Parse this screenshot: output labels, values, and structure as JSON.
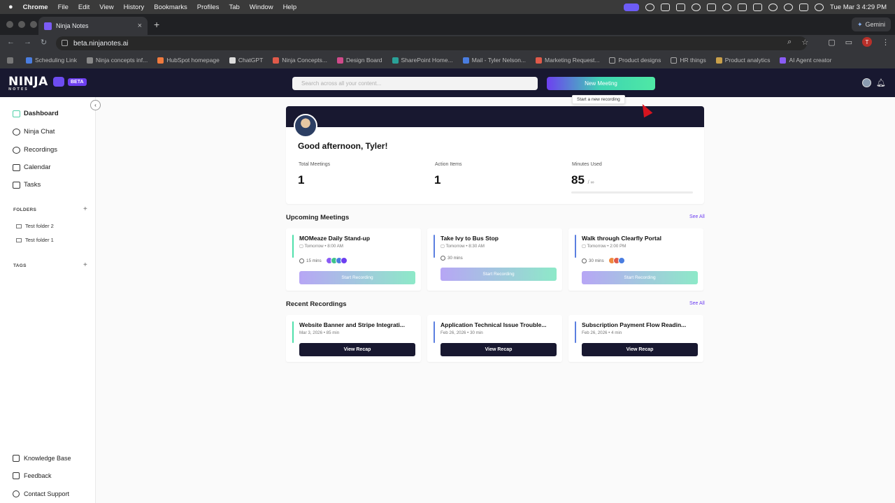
{
  "mac_menu": {
    "items": [
      "Chrome",
      "File",
      "Edit",
      "View",
      "History",
      "Bookmarks",
      "Profiles",
      "Tab",
      "Window",
      "Help"
    ],
    "date_time": "Tue Mar 3  4:29 PM"
  },
  "browser": {
    "tab_title": "Ninja Notes",
    "new_tab": "+",
    "gemini_label": "Gemini",
    "url": "beta.ninjanotes.ai",
    "profile_initial": "T",
    "bookmarks": [
      "Scheduling Link",
      "Ninja concepts inf...",
      "HubSpot homepage",
      "ChatGPT",
      "Ninja Concepts...",
      "Design Board",
      "SharePoint Home...",
      "Mail - Tyler Nelson...",
      "Marketing Request...",
      "Product designs",
      "HR things",
      "Product analytics",
      "AI Agent creator"
    ]
  },
  "app": {
    "logo": "NINJA",
    "logo_sub": "NOTES",
    "beta_badge": "BETA",
    "search_placeholder": "Search across all your content...",
    "new_meeting_label": "New Meeting",
    "tooltip": "Start a new recording"
  },
  "sidebar": {
    "collapse_icon": "‹",
    "nav": [
      {
        "label": "Dashboard",
        "icon": "grid-icon"
      },
      {
        "label": "Ninja Chat",
        "icon": "chat-icon"
      },
      {
        "label": "Recordings",
        "icon": "headphones-icon"
      },
      {
        "label": "Calendar",
        "icon": "calendar-icon"
      },
      {
        "label": "Tasks",
        "icon": "tasks-icon"
      }
    ],
    "folders_title": "FOLDERS",
    "folders": [
      "Test folder 2",
      "Test folder 1"
    ],
    "tags_title": "TAGS",
    "bottom": [
      {
        "label": "Knowledge Base",
        "icon": "book-icon"
      },
      {
        "label": "Feedback",
        "icon": "feedback-icon"
      },
      {
        "label": "Contact Support",
        "icon": "support-icon"
      }
    ]
  },
  "dashboard": {
    "greeting": "Good afternoon, Tyler!",
    "stats": [
      {
        "label": "Total Meetings",
        "value": "1"
      },
      {
        "label": "Action Items",
        "value": "1"
      },
      {
        "label": "Minutes Used",
        "value": "85",
        "suffix": "/ ∞"
      }
    ],
    "upcoming_title": "Upcoming Meetings",
    "see_all": "See All",
    "upcoming": [
      {
        "title": "MOMeaze Daily Stand-up",
        "when": "Tomorrow • 8:00 AM",
        "duration": "15 mins",
        "start_label": "Start Recording",
        "attendee_colors": [
          "#8a5cf5",
          "#3ec48b",
          "#4a7de0",
          "#6d3ff0"
        ]
      },
      {
        "title": "Take Ivy to Bus Stop",
        "when": "Tomorrow • 8:30 AM",
        "duration": "30 mins",
        "start_label": "Start Recording",
        "attendee_colors": []
      },
      {
        "title": "Walk through Clearfly Portal",
        "when": "Tomorrow • 2:00 PM",
        "duration": "30 mins",
        "start_label": "Start Recording",
        "attendee_colors": [
          "#f08a3e",
          "#e05a4a",
          "#4a7de0"
        ]
      }
    ],
    "recent_title": "Recent Recordings",
    "recent": [
      {
        "title": "Website Banner and Stripe Integrati...",
        "meta": "Mar 3, 2026 • 85 min",
        "recap_label": "View Recap"
      },
      {
        "title": "Application Technical Issue Trouble...",
        "meta": "Feb 26, 2026 • 30 min",
        "recap_label": "View Recap"
      },
      {
        "title": "Subscription Payment Flow Readin...",
        "meta": "Feb 26, 2026 • 4 min",
        "recap_label": "View Recap"
      }
    ]
  }
}
